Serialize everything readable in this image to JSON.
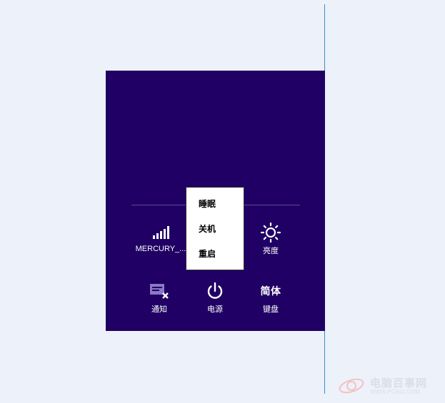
{
  "settings": {
    "network_label": "MERCURY_...",
    "brightness_label": "亮度",
    "notifications_label": "通知",
    "power_label": "电源",
    "keyboard_label": "键盘",
    "keyboard_lang": "简体"
  },
  "power_menu": {
    "items": [
      "睡眠",
      "关机",
      "重启"
    ]
  },
  "watermark": {
    "title": "电脑百事网",
    "url": "WWW.PC841.COM"
  },
  "colors": {
    "panel_bg": "#200064",
    "page_bg": "#edf1fa",
    "menu_bg": "#ffffff",
    "accent_line": "#3c8fc8"
  }
}
